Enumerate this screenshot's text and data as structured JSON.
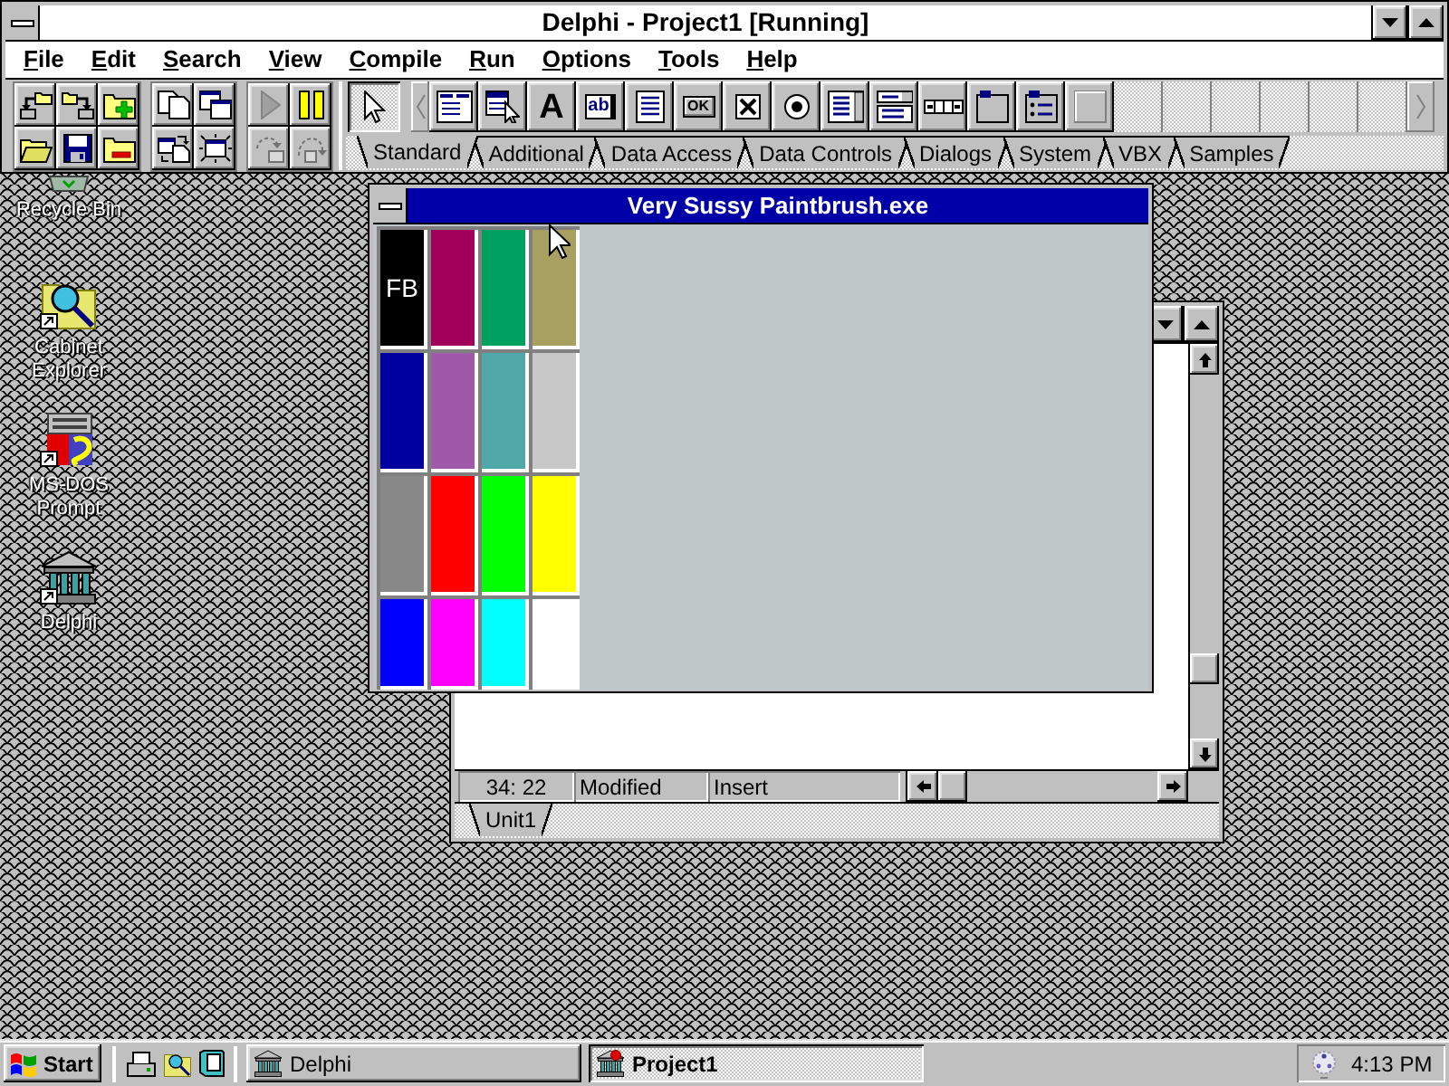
{
  "desktop_icons": [
    {
      "kind": "recycle-bin",
      "label": "Recycle Bin"
    },
    {
      "kind": "explorer",
      "label": "Cabinet Explorer"
    },
    {
      "kind": "ms-dos",
      "label": "MS-DOS Prompt"
    },
    {
      "kind": "delphi",
      "label": "Delphi"
    }
  ],
  "main_window": {
    "title": "Delphi - Project1 [Running]",
    "menu": [
      "File",
      "Edit",
      "Search",
      "View",
      "Compile",
      "Run",
      "Options",
      "Tools",
      "Help"
    ],
    "speedbar": [
      [
        {
          "kind": "open-project",
          "disabled": false
        },
        {
          "kind": "save-project",
          "disabled": false
        },
        {
          "kind": "add-file",
          "disabled": false
        },
        {
          "kind": "open-file",
          "disabled": false
        },
        {
          "kind": "save-file",
          "disabled": false
        },
        {
          "kind": "remove-file",
          "disabled": false
        }
      ],
      [
        {
          "kind": "select-unit",
          "disabled": false
        },
        {
          "kind": "select-form",
          "disabled": false
        },
        {
          "kind": "toggle-form-unit",
          "disabled": false
        },
        {
          "kind": "new-form",
          "disabled": false
        }
      ],
      [
        {
          "kind": "run",
          "disabled": true
        },
        {
          "kind": "pause",
          "disabled": false
        },
        {
          "kind": "trace-into",
          "disabled": true
        },
        {
          "kind": "step-over",
          "disabled": true
        }
      ]
    ],
    "palette": {
      "pointer": {
        "selected": true
      },
      "components": [
        {
          "kind": "main-menu"
        },
        {
          "kind": "popup-menu"
        },
        {
          "kind": "label",
          "glyph": "A"
        },
        {
          "kind": "edit",
          "glyph": "ab"
        },
        {
          "kind": "memo"
        },
        {
          "kind": "button",
          "glyph": "OK"
        },
        {
          "kind": "checkbox"
        },
        {
          "kind": "radio"
        },
        {
          "kind": "listbox"
        },
        {
          "kind": "combobox"
        },
        {
          "kind": "scrollbar"
        },
        {
          "kind": "groupbox"
        },
        {
          "kind": "radiogroup"
        },
        {
          "kind": "panel"
        }
      ],
      "tabs": [
        {
          "label": "Standard",
          "selected": true
        },
        {
          "label": "Additional",
          "selected": false
        },
        {
          "label": "Data Access",
          "selected": false
        },
        {
          "label": "Data Controls",
          "selected": false
        },
        {
          "label": "Dialogs",
          "selected": false
        },
        {
          "label": "System",
          "selected": false
        },
        {
          "label": "VBX",
          "selected": false
        },
        {
          "label": "Samples",
          "selected": false
        }
      ]
    }
  },
  "editor_window": {
    "status": {
      "position": "34: 22",
      "modified": "Modified",
      "mode": "Insert"
    },
    "tabs": [
      {
        "label": "Unit1",
        "selected": true
      }
    ]
  },
  "paintbrush_window": {
    "title": "Very Sussy Paintbrush.exe",
    "swatches": [
      {
        "color": "#000000",
        "marker": "FB"
      },
      {
        "color": "#a0005a"
      },
      {
        "color": "#00a060"
      },
      {
        "color": "#a8a060"
      },
      {
        "color": "#0000a0"
      },
      {
        "color": "#a058a8"
      },
      {
        "color": "#50a8a8"
      },
      {
        "color": "#c8c8c8"
      },
      {
        "color": "#888888"
      },
      {
        "color": "#ff0000"
      },
      {
        "color": "#00ff00"
      },
      {
        "color": "#ffff00"
      },
      {
        "color": "#0000ff"
      },
      {
        "color": "#ff00ff"
      },
      {
        "color": "#00ffff"
      },
      {
        "color": "#ffffff"
      }
    ]
  },
  "taskbar": {
    "start": "Start",
    "quick_launch": [
      {
        "kind": "printer"
      },
      {
        "kind": "explorer"
      },
      {
        "kind": "notebook"
      }
    ],
    "tasks": [
      {
        "kind": "delphi",
        "label": "Delphi",
        "selected": false
      },
      {
        "kind": "project",
        "label": "Project1",
        "selected": true
      }
    ],
    "clock": "4:13 PM"
  }
}
